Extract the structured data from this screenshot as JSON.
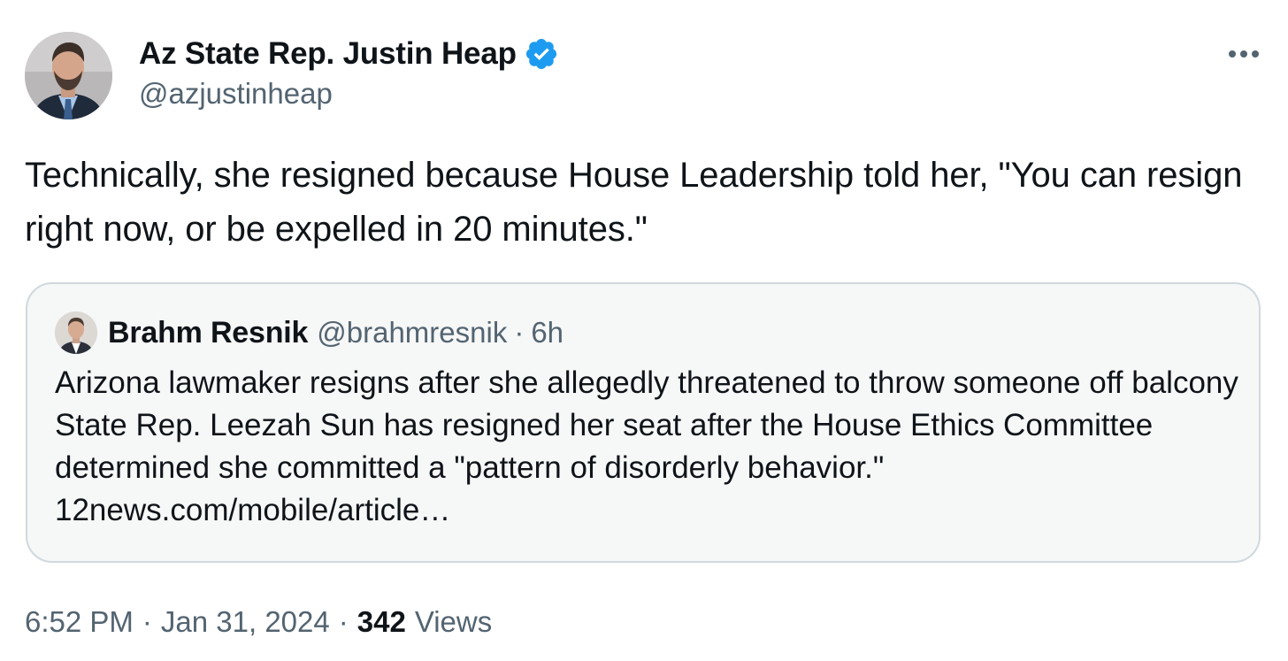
{
  "author": {
    "display_name": "Az State Rep. Justin Heap",
    "handle": "@azjustinheap",
    "verified_icon": "verified-badge-icon",
    "verified_color": "#1d9bf0"
  },
  "more_icon": "more-horizontal-icon",
  "tweet": {
    "text": "Technically, she resigned because House Leadership told her, \"You can resign right now, or be expelled in 20 minutes.\""
  },
  "quote": {
    "author_name": "Brahm Resnik",
    "author_handle": "@brahmresnik",
    "separator": "·",
    "time": "6h",
    "body": "Arizona lawmaker resigns after she allegedly threatened to throw someone off balcony State Rep. Leezah Sun has resigned her seat after the House Ethics Committee determined she committed a \"pattern of disorderly behavior.\" 12news.com/mobile/article…"
  },
  "meta": {
    "time": "6:52 PM",
    "separator": "·",
    "date": "Jan 31, 2024",
    "views_count": "342",
    "views_label": "Views"
  },
  "colors": {
    "text_primary": "#0f1419",
    "text_secondary": "#536471",
    "quote_border": "#cfd9de",
    "quote_background": "#f6f7f7"
  }
}
